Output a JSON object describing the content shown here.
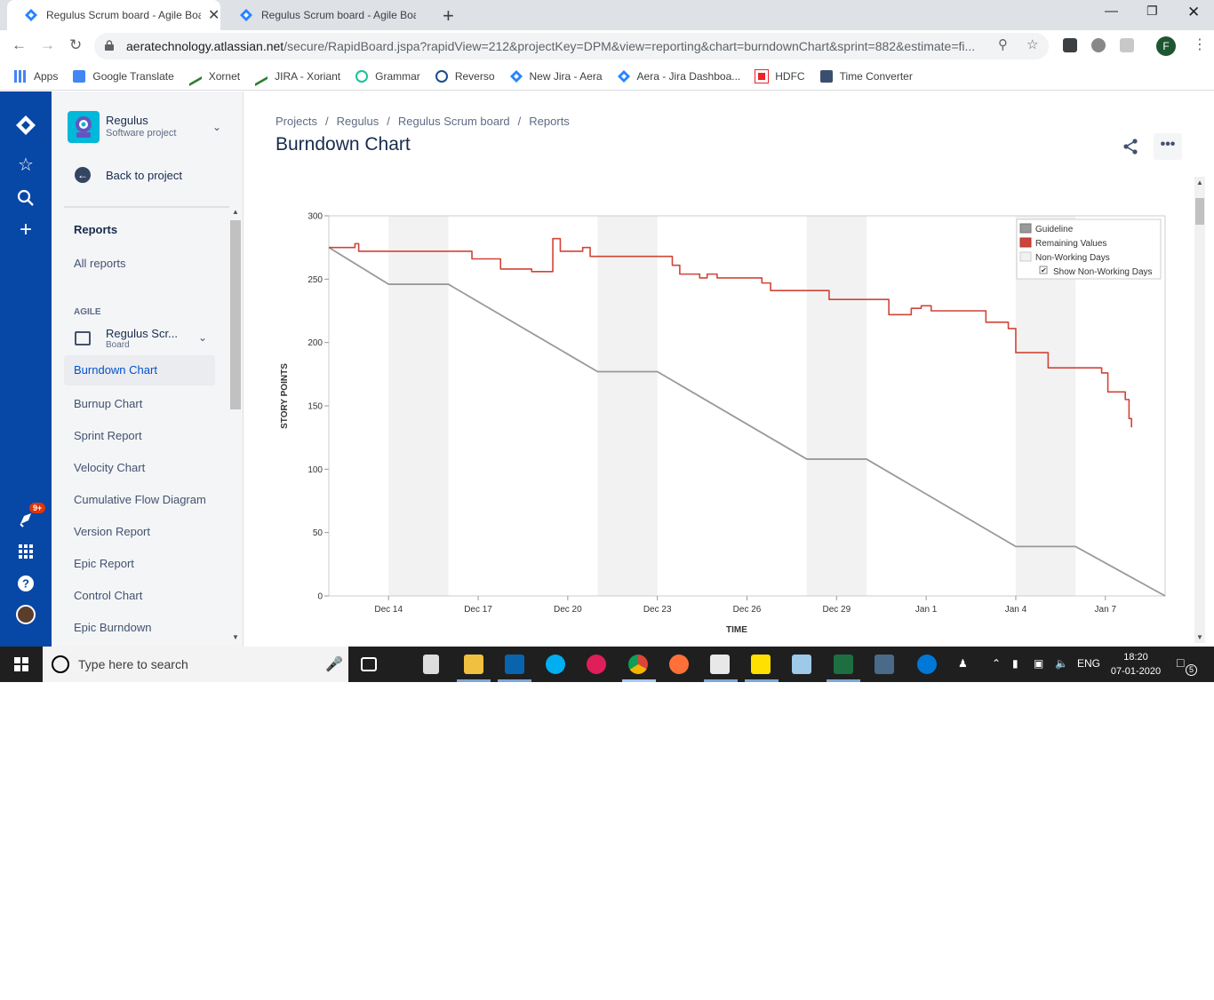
{
  "browser": {
    "tabs": [
      {
        "title": "Regulus Scrum board - Agile Boa",
        "close": "✕"
      },
      {
        "title": "Regulus Scrum board - Agile Boa",
        "close": "✕"
      }
    ],
    "new_tab": "+",
    "url_host": "aeratechnology.atlassian.net",
    "url_path": "/secure/RapidBoard.jspa?rapidView=212&projectKey=DPM&view=reporting&chart=burndownChart&sprint=882&estimate=fi...",
    "profile_initial": "F",
    "bookmarks": [
      "Apps",
      "Google Translate",
      "Xornet",
      "JIRA - Xoriant",
      "Grammar",
      "Reverso",
      "New Jira - Aera",
      "Aera - Jira Dashboa...",
      "HDFC",
      "Time Converter"
    ]
  },
  "global_nav": {
    "notification_count": "9+"
  },
  "sidebar": {
    "project_name": "Regulus",
    "project_type": "Software project",
    "back_label": "Back to project",
    "reports_heading": "Reports",
    "all_reports": "All reports",
    "group_label": "AGILE",
    "board_name": "Regulus Scr...",
    "board_type": "Board",
    "items": [
      "Burndown Chart",
      "Burnup Chart",
      "Sprint Report",
      "Velocity Chart",
      "Cumulative Flow Diagram",
      "Version Report",
      "Epic Report",
      "Control Chart",
      "Epic Burndown"
    ],
    "active_item": "Burndown Chart"
  },
  "main": {
    "breadcrumbs": [
      "Projects",
      "Regulus",
      "Regulus Scrum board",
      "Reports"
    ],
    "page_title": "Burndown Chart"
  },
  "chart_data": {
    "type": "line",
    "xlabel": "TIME",
    "ylabel": "STORY POINTS",
    "ylim": [
      0,
      300
    ],
    "yticks": [
      0,
      50,
      100,
      150,
      200,
      250,
      300
    ],
    "xlim": [
      "2019-12-12",
      "2020-01-09"
    ],
    "xticks": [
      {
        "date": "2019-12-14",
        "label": "Dec 14"
      },
      {
        "date": "2019-12-17",
        "label": "Dec 17"
      },
      {
        "date": "2019-12-20",
        "label": "Dec 20"
      },
      {
        "date": "2019-12-23",
        "label": "Dec 23"
      },
      {
        "date": "2019-12-26",
        "label": "Dec 26"
      },
      {
        "date": "2019-12-29",
        "label": "Dec 29"
      },
      {
        "date": "2020-01-01",
        "label": "Jan 1"
      },
      {
        "date": "2020-01-04",
        "label": "Jan 4"
      },
      {
        "date": "2020-01-07",
        "label": "Jan 7"
      }
    ],
    "non_working_days": [
      [
        "2019-12-14",
        "2019-12-16"
      ],
      [
        "2019-12-21",
        "2019-12-23"
      ],
      [
        "2019-12-28",
        "2019-12-30"
      ],
      [
        "2020-01-04",
        "2020-01-06"
      ]
    ],
    "series": [
      {
        "name": "Guideline",
        "color": "#999999",
        "points": [
          [
            "2019-12-12",
            275
          ],
          [
            "2019-12-14",
            246
          ],
          [
            "2019-12-16",
            246
          ],
          [
            "2019-12-21",
            177
          ],
          [
            "2019-12-23",
            177
          ],
          [
            "2019-12-28",
            108
          ],
          [
            "2019-12-30",
            108
          ],
          [
            "2020-01-04",
            39
          ],
          [
            "2020-01-06",
            39
          ],
          [
            "2020-01-09",
            0
          ]
        ]
      },
      {
        "name": "Remaining Values",
        "color": "#d04437",
        "step": true,
        "points": [
          [
            "2019-12-12",
            275
          ],
          [
            "2019-12-12T21:00",
            278
          ],
          [
            "2019-12-13",
            272
          ],
          [
            "2019-12-16T19:00",
            266
          ],
          [
            "2019-12-17T18:00",
            258
          ],
          [
            "2019-12-18T19:00",
            256
          ],
          [
            "2019-12-19T12:00",
            282
          ],
          [
            "2019-12-19T18:00",
            272
          ],
          [
            "2019-12-20T12:00",
            275
          ],
          [
            "2019-12-20T18:00",
            268
          ],
          [
            "2019-12-23T12:00",
            261
          ],
          [
            "2019-12-23T18:00",
            254
          ],
          [
            "2019-12-24T10:00",
            251
          ],
          [
            "2019-12-24T16:00",
            254
          ],
          [
            "2019-12-25",
            251
          ],
          [
            "2019-12-26T12:00",
            247
          ],
          [
            "2019-12-26T19:00",
            241
          ],
          [
            "2019-12-28T18:00",
            234
          ],
          [
            "2019-12-30T18:00",
            222
          ],
          [
            "2019-12-31T12:00",
            227
          ],
          [
            "2019-12-31T20:00",
            229
          ],
          [
            "2020-01-01T04:00",
            225
          ],
          [
            "2020-01-03",
            216
          ],
          [
            "2020-01-03T18:00",
            211
          ],
          [
            "2020-01-04",
            192
          ],
          [
            "2020-01-05T02:00",
            180
          ],
          [
            "2020-01-06T21:00",
            176
          ],
          [
            "2020-01-07T02:00",
            161
          ],
          [
            "2020-01-07T16:00",
            155
          ],
          [
            "2020-01-07T19:00",
            140
          ],
          [
            "2020-01-07T21:00",
            133
          ]
        ]
      }
    ],
    "legend": {
      "position": "top-right",
      "entries": [
        {
          "label": "Guideline",
          "color": "#999999"
        },
        {
          "label": "Remaining Values",
          "color": "#d04437"
        },
        {
          "label": "Non-Working Days",
          "color": "#f2f2f2"
        }
      ],
      "checkbox_label": "Show Non-Working Days",
      "checkbox_checked": true
    }
  },
  "taskbar": {
    "search_placeholder": "Type here to search",
    "language": "ENG",
    "time": "18:20",
    "date": "07-01-2020",
    "notification_count": "5"
  }
}
